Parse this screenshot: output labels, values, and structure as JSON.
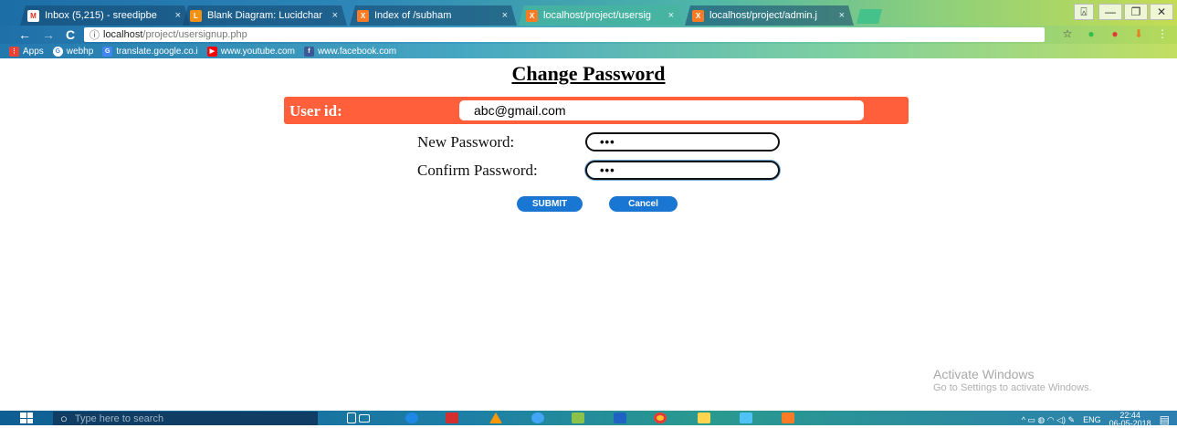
{
  "browser": {
    "tabs": [
      {
        "title": "Inbox (5,215) - sreedipbe",
        "favicon": "gmail-icon",
        "color": "#d93025",
        "glyph": "M",
        "active": false
      },
      {
        "title": "Blank Diagram: Lucidchar",
        "favicon": "lucidchart-icon",
        "color": "#f29111",
        "glyph": "L",
        "active": false
      },
      {
        "title": "Index of /subham",
        "favicon": "xampp-icon",
        "color": "#fb7a24",
        "glyph": "X",
        "active": false
      },
      {
        "title": "localhost/project/usersig",
        "favicon": "xampp-icon",
        "color": "#fb7a24",
        "glyph": "X",
        "active": true
      },
      {
        "title": "localhost/project/admin.j",
        "favicon": "xampp-icon",
        "color": "#fb7a24",
        "glyph": "X",
        "active": false
      }
    ],
    "tab_close_glyph": "×",
    "window_controls": {
      "profile": "⍓",
      "minimize": "—",
      "maximize": "❐",
      "close": "✕"
    },
    "nav": {
      "back": "←",
      "forward": "→",
      "reload": "C"
    },
    "url": {
      "info": "ⓘ",
      "host": "localhost",
      "path": "/project/usersignup.php"
    },
    "toolbar_icons": {
      "star": "☆",
      "ext1": "●",
      "ext2": "●",
      "download": "⬇",
      "menu": "⋮"
    },
    "bookmarks": [
      {
        "label": "Apps",
        "icon": "apps-icon",
        "color": "#ea4335",
        "glyph": "⋮"
      },
      {
        "label": "webhp",
        "icon": "google-icon",
        "color": "#ffffff",
        "glyph": "G"
      },
      {
        "label": "translate.google.co.i",
        "icon": "translate-icon",
        "color": "#4285f4",
        "glyph": "G"
      },
      {
        "label": "www.youtube.com",
        "icon": "youtube-icon",
        "color": "#ff0000",
        "glyph": "▶"
      },
      {
        "label": "www.facebook.com",
        "icon": "facebook-icon",
        "color": "#3b5998",
        "glyph": "f"
      }
    ]
  },
  "page": {
    "title": "Change Password",
    "user_id_label": "User id:",
    "user_id_value": "abc@gmail.com",
    "new_password_label": "New Password:",
    "new_password_value": "•••",
    "confirm_password_label": "Confirm Password:",
    "confirm_password_value": "•••",
    "submit_label": "SUBMIT",
    "cancel_label": "Cancel",
    "accent_color": "#ff5f3a",
    "button_color": "#1976d2"
  },
  "watermark": {
    "line1": "Activate Windows",
    "line2": "Go to Settings to activate Windows."
  },
  "taskbar": {
    "search_icon": "○",
    "search_placeholder": "Type here to search",
    "tray_symbols": "^ ▭ ◍ ◠ ◁) ✎",
    "language": "ENG",
    "time": "22:44",
    "date": "06-05-2018",
    "notifications_glyph": "▤"
  }
}
